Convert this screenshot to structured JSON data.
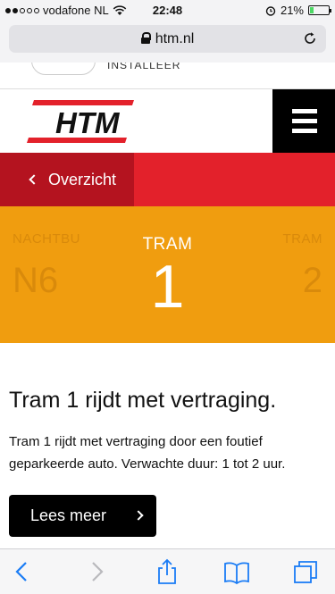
{
  "status_bar": {
    "carrier": "vodafone NL",
    "time": "22:48",
    "battery": "21%",
    "battery_level": 0.21,
    "signal_bars": 2
  },
  "browser": {
    "url": "htm.nl"
  },
  "banner": {
    "label": "INSTALLEER"
  },
  "header": {
    "logo_text": "HTM"
  },
  "nav": {
    "back_label": "Overzicht"
  },
  "carousel": {
    "prev": {
      "kind": "NACHTBU",
      "number": "N6"
    },
    "current": {
      "kind": "TRAM",
      "number": "1"
    },
    "next": {
      "kind": "TRAM",
      "number": "2"
    }
  },
  "notice": {
    "title": "Tram 1 rijdt met vertraging.",
    "body": "Tram 1 rijdt met vertraging door een foutief geparkeerde auto. Verwachte duur: 1 tot 2 uur.",
    "button_label": "Lees meer"
  },
  "colors": {
    "red": "#e3212b",
    "dark_red": "#b4131f",
    "orange": "#f09d0f",
    "accent_blue": "#1a7cf5"
  }
}
